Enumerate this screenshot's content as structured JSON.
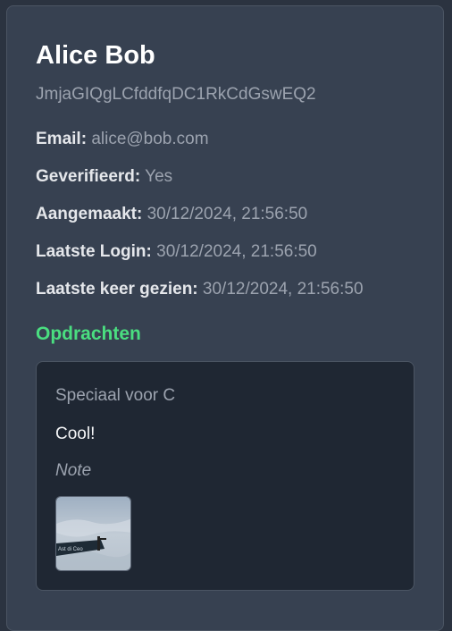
{
  "user": {
    "name": "Alice Bob",
    "uid": "JmjaGIQgLCfddfqDC1RkCdGswEQ2",
    "fields": [
      {
        "label": "Email:",
        "value": "alice@bob.com"
      },
      {
        "label": "Geverifieerd:",
        "value": "Yes"
      },
      {
        "label": "Aangemaakt:",
        "value": "30/12/2024, 21:56:50"
      },
      {
        "label": "Laatste Login:",
        "value": "30/12/2024, 21:56:50"
      },
      {
        "label": "Laatste keer gezien:",
        "value": "30/12/2024, 21:56:50"
      }
    ]
  },
  "assignments": {
    "title": "Opdrachten",
    "items": [
      {
        "title": "Speciaal voor C",
        "description": "Cool!",
        "note": "Note",
        "image": "street-sign-photo"
      }
    ]
  }
}
